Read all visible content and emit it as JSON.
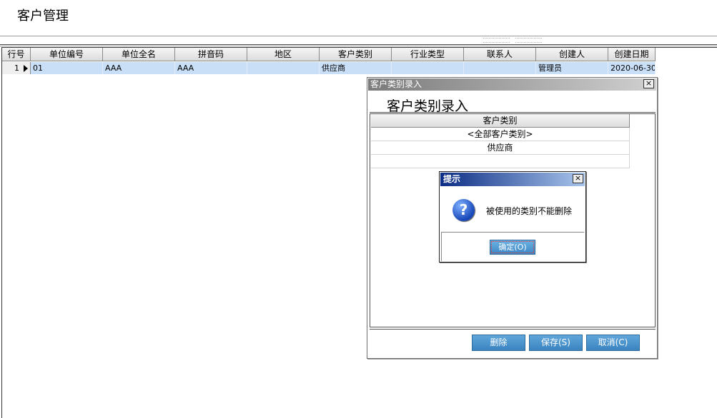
{
  "page_title": "客户管理",
  "grid": {
    "columns": [
      {
        "label": "行号",
        "width": 40
      },
      {
        "label": "单位编号",
        "width": 101
      },
      {
        "label": "单位全名",
        "width": 101
      },
      {
        "label": "拼音码",
        "width": 101
      },
      {
        "label": "地区",
        "width": 101
      },
      {
        "label": "客户类别",
        "width": 101
      },
      {
        "label": "行业类型",
        "width": 101
      },
      {
        "label": "联系人",
        "width": 101
      },
      {
        "label": "创建人",
        "width": 101
      },
      {
        "label": "创建日期",
        "width": 66
      }
    ],
    "rows": [
      {
        "rownum": "1",
        "cells": [
          "01",
          "AAA",
          "AAA",
          "",
          "供应商",
          "",
          "",
          "管理员",
          "2020-06-30"
        ]
      }
    ],
    "selected_color": "#c9dff7"
  },
  "category_dialog": {
    "title": "客户类别录入",
    "heading": "客户类别录入",
    "column_header": "客户类别",
    "items": [
      "<全部客户类别>",
      "供应商",
      ""
    ],
    "buttons": {
      "delete": "删除",
      "save": "保存(S)",
      "cancel": "取消(C)"
    },
    "close_glyph": "×"
  },
  "alert": {
    "title": "提示",
    "icon": "question-icon",
    "icon_glyph": "?",
    "message": "被使用的类别不能删除",
    "ok_label": "确定(O)",
    "close_glyph": "×"
  }
}
